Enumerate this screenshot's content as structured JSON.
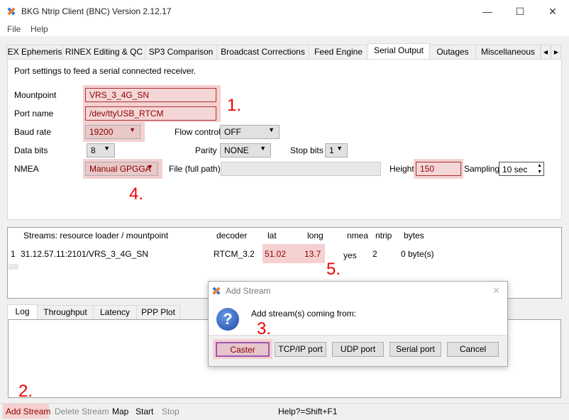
{
  "window": {
    "title": "BKG Ntrip Client (BNC) Version 2.12.17",
    "minimize": "—",
    "maximize": "☐",
    "close": "✕"
  },
  "menu": [
    "File",
    "Help"
  ],
  "tabs": [
    "EX Ephemeris",
    "RINEX Editing & QC",
    "SP3 Comparison",
    "Broadcast Corrections",
    "Feed Engine",
    "Serial Output",
    "Outages",
    "Miscellaneous"
  ],
  "tab_scroll": {
    "left": "◀",
    "right": "▶"
  },
  "serial": {
    "description": "Port settings to feed a serial connected receiver.",
    "mountpoint_label": "Mountpoint",
    "mountpoint": "VRS_3_4G_SN",
    "portname_label": "Port name",
    "portname": "/dev/ttyUSB_RTCM",
    "baud_label": "Baud rate",
    "baud": "19200",
    "flow_label": "Flow control",
    "flow": "OFF",
    "databits_label": "Data bits",
    "databits": "8",
    "parity_label": "Parity",
    "parity": "NONE",
    "stopbits_label": "Stop bits",
    "stopbits": "1",
    "nmea_label": "NMEA",
    "nmea": "Manual GPGGA",
    "file_label": "File (full path)",
    "file": "",
    "height_label": "Height",
    "height": "150",
    "sampling_label": "Sampling",
    "sampling": "10 sec"
  },
  "annotations": {
    "a1": "1.",
    "a2": "2.",
    "a3": "3.",
    "a4": "4.",
    "a5": "5."
  },
  "streams": {
    "headers": [
      "Streams:  resource loader / mountpoint",
      "decoder",
      "lat",
      "long",
      "nmea",
      "ntrip",
      "bytes"
    ],
    "rows": [
      {
        "index": "1",
        "mountpoint": "31.12.57.11:2101/VRS_3_4G_SN",
        "decoder": "RTCM_3.2",
        "lat": "51.02",
        "long": "13.7",
        "nmea": "yes",
        "ntrip": "2",
        "bytes": "0 byte(s)"
      }
    ]
  },
  "bottom_tabs": [
    "Log",
    "Throughput",
    "Latency",
    "PPP Plot"
  ],
  "toolbar": {
    "add": "Add Stream",
    "delete": "Delete Stream",
    "map": "Map",
    "start": "Start",
    "stop": "Stop",
    "help": "Help?=Shift+F1"
  },
  "dialog": {
    "title": "Add Stream",
    "close": "✕",
    "message": "Add stream(s) coming from:",
    "icon": "?",
    "buttons": [
      "Caster",
      "TCP/IP port",
      "UDP port",
      "Serial port",
      "Cancel"
    ]
  }
}
